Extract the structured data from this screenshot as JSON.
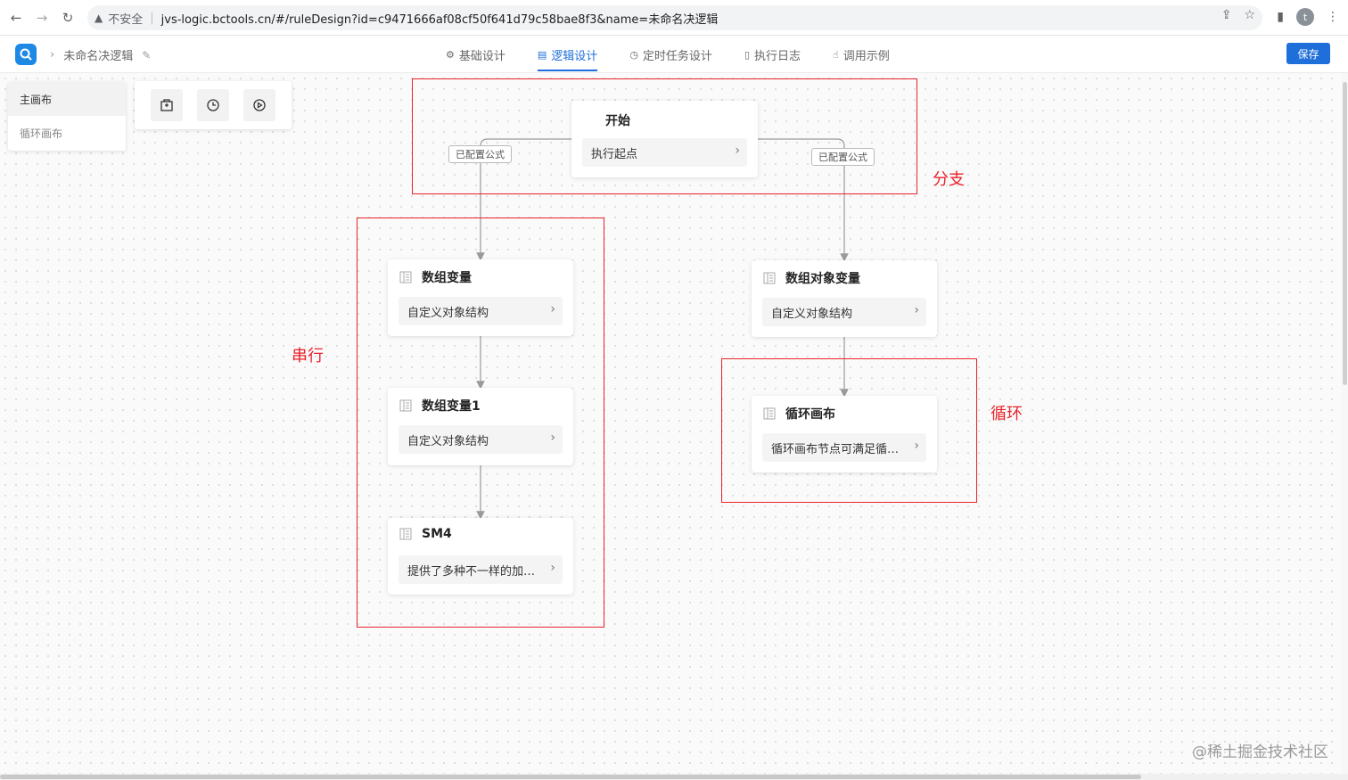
{
  "browser": {
    "security_label": "不安全",
    "url": "jvs-logic.bctools.cn/#/ruleDesign?id=c9471666af08cf50f641d79c58bae8f3&name=未命名决逻辑",
    "profile_initial": "t"
  },
  "header": {
    "breadcrumb": "未命名决逻辑",
    "tabs": [
      {
        "label": "基础设计",
        "icon": "gear-icon"
      },
      {
        "label": "逻辑设计",
        "icon": "document-icon",
        "active": true
      },
      {
        "label": "定时任务设计",
        "icon": "clock-icon"
      },
      {
        "label": "执行日志",
        "icon": "file-icon"
      },
      {
        "label": "调用示例",
        "icon": "hand-icon"
      }
    ],
    "save_label": "保存",
    "accent_color": "#1e6fd9"
  },
  "canvas_list": {
    "items": [
      {
        "label": "主画布",
        "active": true
      },
      {
        "label": "循环画布",
        "active": false
      }
    ]
  },
  "toolbar": {
    "tools": [
      "package-icon",
      "clock-icon",
      "play-icon"
    ]
  },
  "flow": {
    "start": {
      "title": "开始",
      "body": "执行起点"
    },
    "formula_tags": [
      "已配置公式",
      "已配置公式"
    ],
    "nodes": [
      {
        "title": "数组变量",
        "body": "自定义对象结构"
      },
      {
        "title": "数组变量1",
        "body": "自定义对象结构"
      },
      {
        "title": "SM4",
        "body": "提供了多种不一样的加密方式"
      },
      {
        "title": "数组对象变量",
        "body": "自定义对象结构"
      },
      {
        "title": "循环画布",
        "body": "循环画布节点可满足循环执行"
      }
    ]
  },
  "annotations": {
    "branch": "分支",
    "serial": "串行",
    "loop": "循环",
    "color": "#e8232a"
  },
  "watermark": "@稀土掘金技术社区"
}
